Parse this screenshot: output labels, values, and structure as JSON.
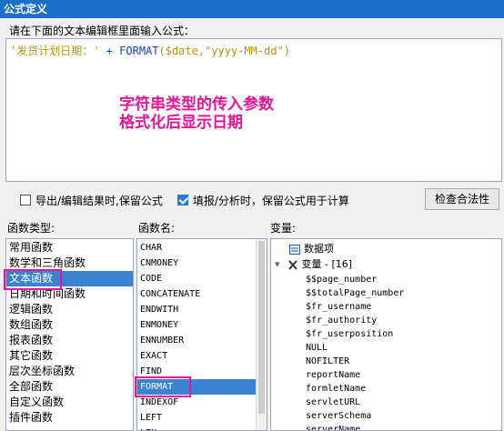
{
  "window": {
    "title": "公式定义"
  },
  "editor": {
    "instruction": "请在下面的文本编辑框里面输入公式：",
    "formula_string": "'发货计划日期：'",
    "formula_plus": " + ",
    "formula_func": "FORMAT",
    "formula_args": "($date,\"yyyy-MM-dd\")",
    "annotation_line1": "字符串类型的传入参数",
    "annotation_line2": "格式化后显示日期"
  },
  "options": {
    "export_label": "导出/编辑结果时,保留公式",
    "export_checked": false,
    "fill_label": "填报/分析时，保留公式用于计算",
    "fill_checked": true,
    "check_button": "检查合法性"
  },
  "categories": {
    "label": "函数类型:",
    "items": [
      "常用函数",
      "数学和三角函数",
      "文本函数",
      "日期和时间函数",
      "逻辑函数",
      "数组函数",
      "报表函数",
      "其它函数",
      "层次坐标函数",
      "全部函数",
      "自定义函数",
      "插件函数"
    ],
    "selected": "文本函数"
  },
  "functions": {
    "label": "函数名:",
    "items": [
      "CHAR",
      "CNMONEY",
      "CODE",
      "CONCATENATE",
      "ENDWITH",
      "ENMONEY",
      "ENNUMBER",
      "EXACT",
      "FIND",
      "FORMAT",
      "INDEXOF",
      "LEFT",
      "LEN"
    ],
    "selected": "FORMAT"
  },
  "variables": {
    "label": "变量:",
    "data_item": "数据项",
    "var_group": "变量 - [16]",
    "items": [
      "$$page_number",
      "$$totalPage_number",
      "$fr_username",
      "$fr_authority",
      "$fr_userposition",
      "NULL",
      "NOFILTER",
      "reportName",
      "formletName",
      "servletURL",
      "serverSchema",
      "serverName"
    ]
  },
  "colors": {
    "title_bar": "#1c6fc9",
    "selection": "#3b83d0",
    "highlight": "#e6149b"
  }
}
